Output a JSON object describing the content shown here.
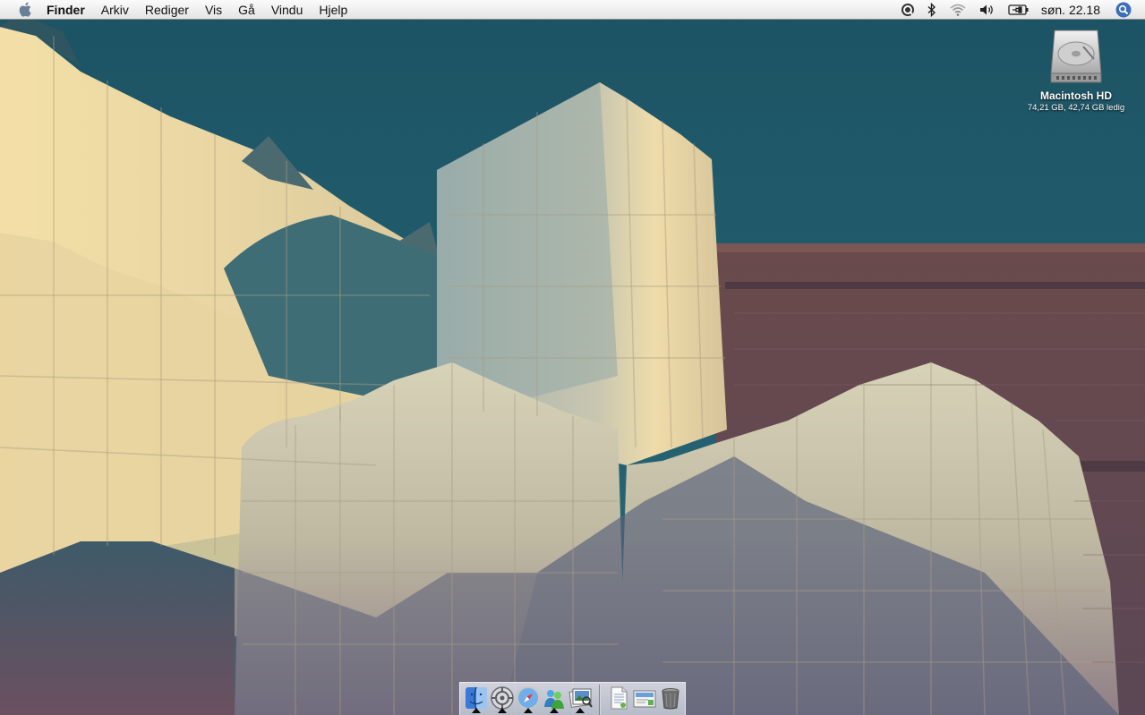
{
  "menubar": {
    "app_name": "Finder",
    "menus": [
      "Arkiv",
      "Rediger",
      "Vis",
      "Gå",
      "Vindu",
      "Hjelp"
    ],
    "clock": "søn. 22.18",
    "status_icons": [
      "quicktime-icon",
      "bluetooth-icon",
      "wifi-icon",
      "volume-icon",
      "battery-icon",
      "spotlight-icon"
    ]
  },
  "desktop": {
    "hd_icon": {
      "name": "Macintosh HD",
      "info": "74,21 GB, 42,74 GB ledig"
    }
  },
  "dock": {
    "apps": [
      "finder",
      "system-preferences",
      "safari",
      "messenger",
      "preview"
    ],
    "docs": [
      "document",
      "mail-document",
      "trash"
    ]
  }
}
